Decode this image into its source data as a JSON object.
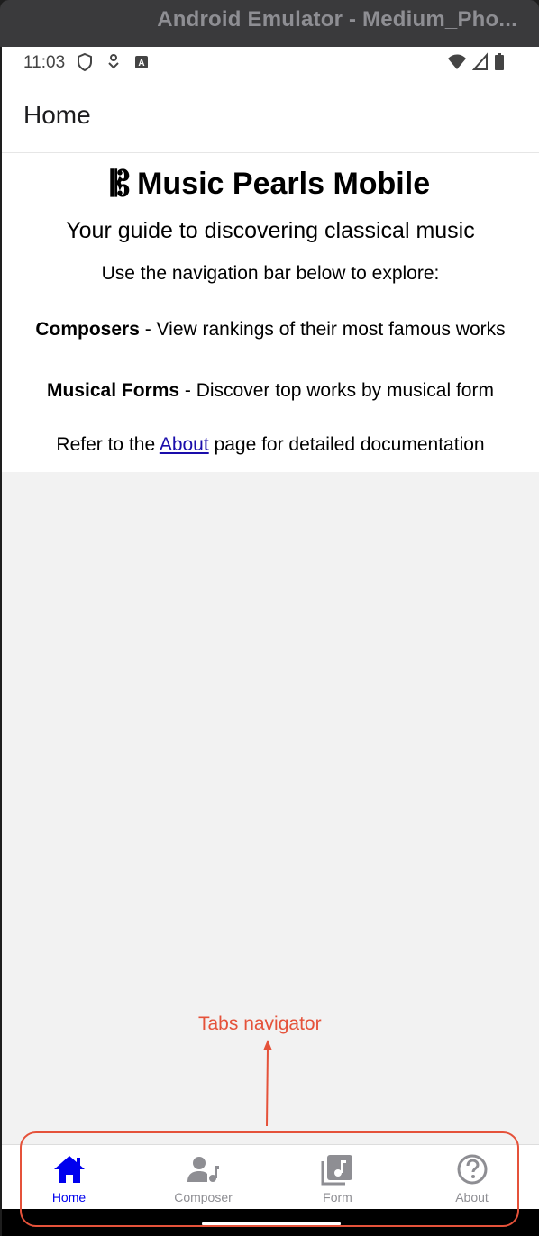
{
  "window": {
    "title": "Android Emulator - Medium_Pho..."
  },
  "statusbar": {
    "time": "11:03"
  },
  "header": {
    "title": "Home"
  },
  "content": {
    "app_title": "Music Pearls Mobile",
    "clef_glyph": "𝄡",
    "tagline": "Your guide to discovering classical music",
    "nav_hint": "Use the navigation bar below to explore:",
    "composers_bold": "Composers",
    "composers_text": " - View rankings of their most famous works",
    "forms_bold": "Musical Forms",
    "forms_text": " - Discover top works by musical form",
    "refer_prefix": "Refer to the ",
    "refer_link": "About",
    "refer_suffix": " page for detailed documentation"
  },
  "annotation": {
    "label": "Tabs navigator",
    "color": "#e5523a"
  },
  "tabs": [
    {
      "label": "Home",
      "icon": "home-icon",
      "active": true
    },
    {
      "label": "Composer",
      "icon": "composer-icon",
      "active": false
    },
    {
      "label": "Form",
      "icon": "music-library-icon",
      "active": false
    },
    {
      "label": "About",
      "icon": "help-circle-icon",
      "active": false
    }
  ],
  "colors": {
    "active_tab": "#0000ee",
    "inactive_tab": "#8e8e93",
    "link": "#1a0dab"
  }
}
